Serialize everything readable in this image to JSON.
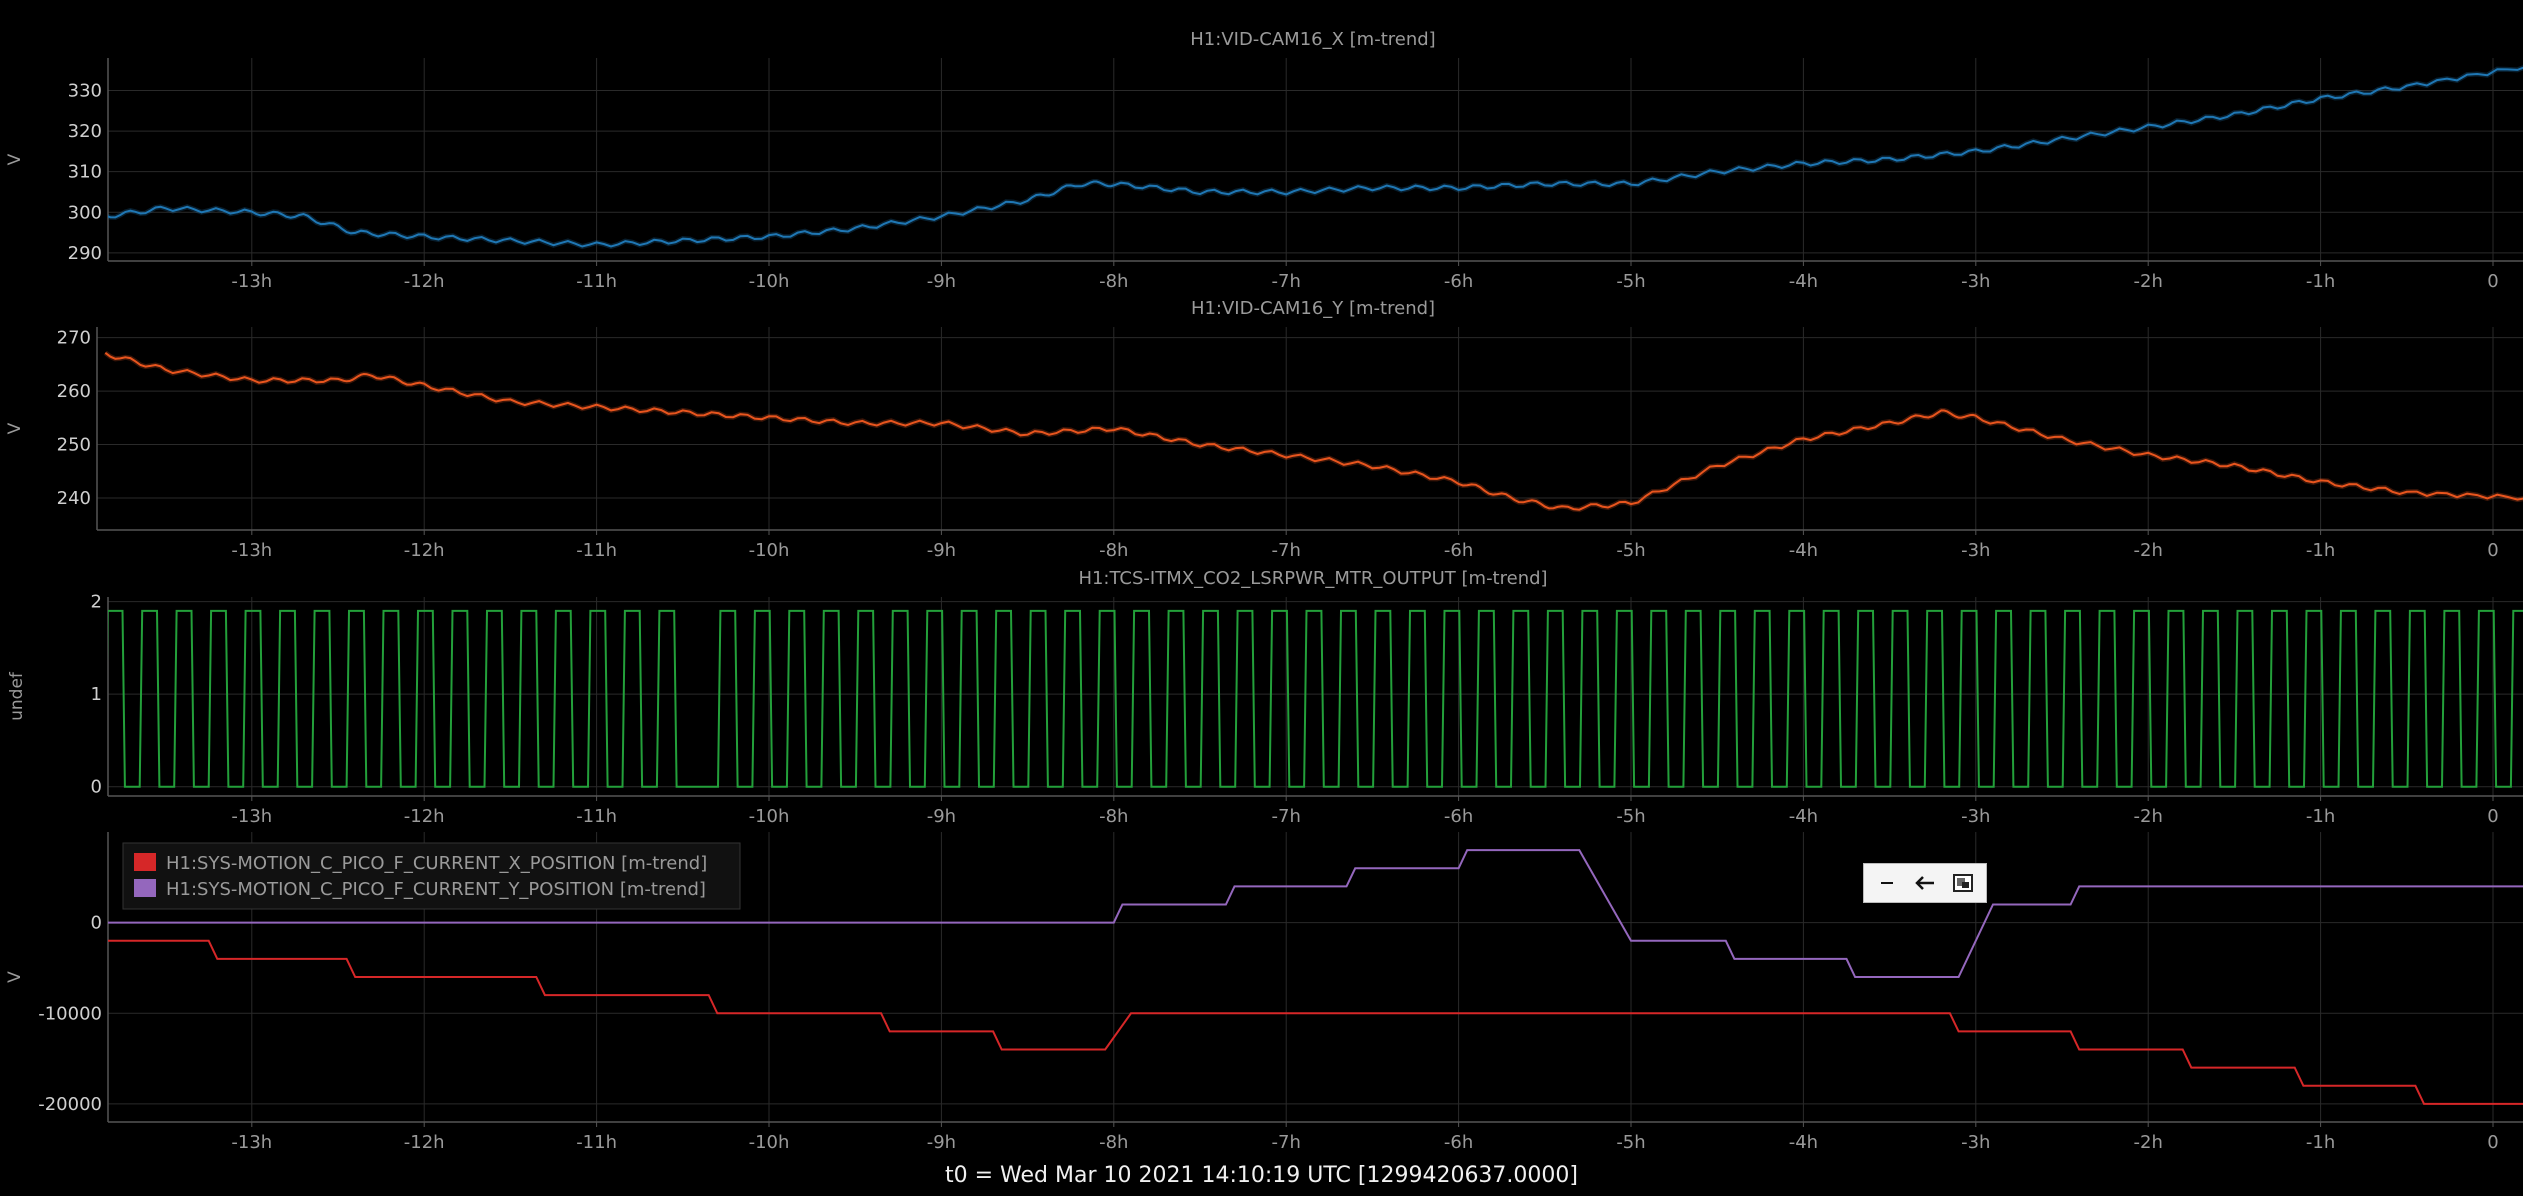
{
  "footer": {
    "t0_label": "t0 = Wed Mar 10 2021 14:10:19 UTC [1299420637.0000]"
  },
  "toolbar": {
    "minimize_icon": "minus-icon",
    "back_icon": "arrow-left-icon",
    "restore_icon": "restore-window-icon"
  },
  "colors": {
    "background": "#000000",
    "grid": "#2a2a2a",
    "axis_text": "#9a9a9a",
    "series_blue": "#1f77b4",
    "series_orange": "#e8551e",
    "series_green": "#23a03a",
    "series_red": "#d62728",
    "series_purple": "#9467bd"
  },
  "chart_data": [
    {
      "type": "line",
      "title": "H1:VID-CAM16_X [m-trend]",
      "ylabel": "V",
      "x_tick_labels": [
        "-13h",
        "-12h",
        "-11h",
        "-10h",
        "-9h",
        "-8h",
        "-7h",
        "-6h",
        "-5h",
        "-4h",
        "-3h",
        "-2h",
        "-1h",
        "0"
      ],
      "y_tick_labels": [
        "290",
        "300",
        "310",
        "320",
        "330"
      ],
      "y_ticks": [
        290,
        300,
        310,
        320,
        330
      ],
      "xlim": [
        -13.85,
        0.2
      ],
      "ylim": [
        288,
        338
      ],
      "grid": true,
      "series": [
        {
          "color": "#1f77b4",
          "x": [
            -13.85,
            -13.5,
            -13.0,
            -12.7,
            -12.4,
            -12.0,
            -11.5,
            -11.0,
            -10.5,
            -10.0,
            -9.5,
            -9.0,
            -8.5,
            -8.2,
            -8.0,
            -7.5,
            -7.0,
            -6.5,
            -6.0,
            -5.5,
            -5.0,
            -4.5,
            -4.0,
            -3.5,
            -3.0,
            -2.5,
            -2.0,
            -1.5,
            -1.0,
            -0.5,
            0.2
          ],
          "y": [
            299,
            301,
            300,
            299,
            295,
            294,
            293,
            292,
            293,
            294,
            296,
            299,
            303,
            307,
            307,
            305,
            305,
            306,
            306,
            307,
            307,
            310,
            312,
            313,
            315,
            318,
            321,
            324,
            328,
            331,
            336
          ]
        }
      ]
    },
    {
      "type": "line",
      "title": "H1:VID-CAM16_Y [m-trend]",
      "ylabel": "V",
      "x_tick_labels": [
        "-13h",
        "-12h",
        "-11h",
        "-10h",
        "-9h",
        "-8h",
        "-7h",
        "-6h",
        "-5h",
        "-4h",
        "-3h",
        "-2h",
        "-1h",
        "0"
      ],
      "y_tick_labels": [
        "240",
        "250",
        "260",
        "270"
      ],
      "y_ticks": [
        240,
        250,
        260,
        270
      ],
      "xlim": [
        -13.85,
        0.2
      ],
      "ylim": [
        234,
        272
      ],
      "grid": true,
      "series": [
        {
          "color": "#e8551e",
          "x": [
            -13.85,
            -13.5,
            -13.0,
            -12.5,
            -12.3,
            -12.0,
            -11.5,
            -11.0,
            -10.5,
            -10.0,
            -9.5,
            -9.0,
            -8.5,
            -8.0,
            -7.5,
            -7.0,
            -6.5,
            -6.0,
            -5.7,
            -5.4,
            -5.0,
            -4.5,
            -4.0,
            -3.5,
            -3.2,
            -3.0,
            -2.5,
            -2.0,
            -1.5,
            -1.0,
            -0.5,
            0.2
          ],
          "y": [
            267,
            264,
            262,
            262,
            263,
            261,
            258,
            257,
            256,
            255,
            254,
            254,
            252,
            253,
            250,
            248,
            246,
            243,
            240,
            238,
            239,
            246,
            251,
            254,
            256,
            255,
            251,
            248,
            246,
            243,
            241,
            240
          ]
        }
      ]
    },
    {
      "type": "line",
      "title": "H1:TCS-ITMX_CO2_LSRPWR_MTR_OUTPUT [m-trend]",
      "ylabel": "undef",
      "x_tick_labels": [
        "-13h",
        "-12h",
        "-11h",
        "-10h",
        "-9h",
        "-8h",
        "-7h",
        "-6h",
        "-5h",
        "-4h",
        "-3h",
        "-2h",
        "-1h",
        "0"
      ],
      "y_tick_labels": [
        "0",
        "1",
        "2"
      ],
      "y_ticks": [
        0,
        1,
        2
      ],
      "xlim": [
        -13.85,
        0.2
      ],
      "ylim": [
        -0.1,
        2.05
      ],
      "grid": true,
      "series": [
        {
          "color": "#23a03a",
          "waveform": "square",
          "low": 0,
          "high": 1.9,
          "period_hours": 0.2
        }
      ]
    },
    {
      "type": "line",
      "title": "",
      "ylabel": "V",
      "x_tick_labels": [
        "-13h",
        "-12h",
        "-11h",
        "-10h",
        "-9h",
        "-8h",
        "-7h",
        "-6h",
        "-5h",
        "-4h",
        "-3h",
        "-2h",
        "-1h",
        "0"
      ],
      "y_tick_labels": [
        "-20000",
        "-10000",
        "0"
      ],
      "y_ticks": [
        -20000,
        -10000,
        0
      ],
      "xlim": [
        -13.85,
        0.2
      ],
      "ylim": [
        -22000,
        10000
      ],
      "grid": true,
      "legend_position": "top-left",
      "series": [
        {
          "name": "H1:SYS-MOTION_C_PICO_F_CURRENT_X_POSITION [m-trend]",
          "color": "#d62728",
          "x": [
            -13.85,
            -13.25,
            -13.2,
            -12.45,
            -12.4,
            -11.35,
            -11.3,
            -10.35,
            -10.3,
            -9.35,
            -9.3,
            -8.7,
            -8.65,
            -8.05,
            -7.9,
            -3.15,
            -3.1,
            -2.45,
            -2.4,
            -1.8,
            -1.75,
            -1.15,
            -1.1,
            -0.45,
            -0.4,
            0.2
          ],
          "y": [
            -2000,
            -2000,
            -4000,
            -4000,
            -6000,
            -6000,
            -8000,
            -8000,
            -10000,
            -10000,
            -12000,
            -12000,
            -14000,
            -14000,
            -10000,
            -10000,
            -12000,
            -12000,
            -14000,
            -14000,
            -16000,
            -16000,
            -18000,
            -18000,
            -20000,
            -20000
          ]
        },
        {
          "name": "H1:SYS-MOTION_C_PICO_F_CURRENT_Y_POSITION [m-trend]",
          "color": "#9467bd",
          "x": [
            -13.85,
            -8.0,
            -7.95,
            -7.35,
            -7.3,
            -6.65,
            -6.6,
            -6.0,
            -5.95,
            -5.3,
            -5.0,
            -4.45,
            -4.4,
            -3.75,
            -3.7,
            -3.1,
            -2.9,
            -2.45,
            -2.4,
            0.2
          ],
          "y": [
            0,
            0,
            2000,
            2000,
            4000,
            4000,
            6000,
            6000,
            8000,
            8000,
            -2000,
            -2000,
            -4000,
            -4000,
            -6000,
            -6000,
            2000,
            2000,
            4000,
            4000
          ]
        }
      ]
    }
  ]
}
